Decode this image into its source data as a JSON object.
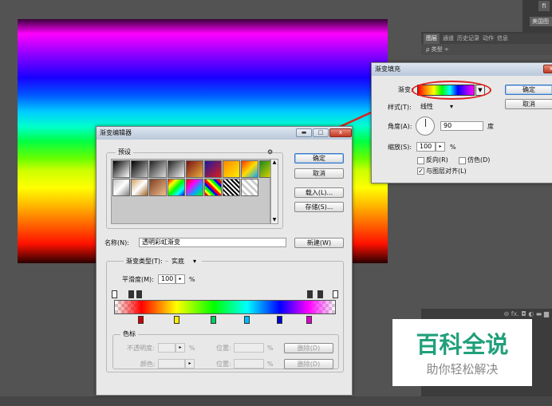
{
  "ps_top": {
    "fi_label": "fi",
    "tab_label": "美国图"
  },
  "layers_panel": {
    "tabs": [
      "图层",
      "通道",
      "历史记录",
      "动作",
      "信息"
    ],
    "filter_label": "ρ 类型 ÷",
    "bottom_icons": "⊖ fx. ◘ ◐ ▬ ▆"
  },
  "gradient_fill": {
    "title": "渐变填充",
    "gradient_label": "渐变:",
    "style_label": "样式(T):",
    "style_value": "线性",
    "angle_label": "角度(A):",
    "angle_value": "90",
    "angle_unit": "度",
    "scale_label": "缩放(S):",
    "scale_value": "100",
    "scale_unit": "%",
    "reverse_label": "反向(R)",
    "dither_label": "仿色(D)",
    "align_label": "与图层对齐(L)",
    "ok_label": "确定",
    "cancel_label": "取消",
    "reverse_checked": false,
    "dither_checked": false,
    "align_checked": true
  },
  "gradient_editor": {
    "title": "渐变编辑器",
    "presets_label": "预设",
    "ok_label": "确定",
    "cancel_label": "取消",
    "load_label": "载入(L)...",
    "save_label": "存储(S)...",
    "name_label": "名称(N):",
    "name_value": "透明彩虹渐变",
    "new_label": "新建(W)",
    "type_label": "渐变类型(T):",
    "type_value": "实底",
    "smooth_label": "平滑度(M):",
    "smooth_value": "100",
    "smooth_unit": "%",
    "stops_label": "色标",
    "opacity_label": "不透明度:",
    "opacity_unit": "%",
    "location_label": "位置:",
    "location_unit": "%",
    "delete_label": "删除(D)",
    "color_label": "颜色:",
    "preset_colors": [
      "linear-gradient(135deg,#000,#fff)",
      "linear-gradient(135deg,#000,rgba(0,0,0,0))",
      "linear-gradient(135deg,#222,#ddd)",
      "linear-gradient(135deg,#222,#f5f5f5)",
      "linear-gradient(135deg,#7a1010,#e8b040)",
      "linear-gradient(135deg,#1a1aa0,#e01a1a)",
      "linear-gradient(135deg,#ff8800,#ffee00)",
      "linear-gradient(135deg,#ff3300,#ffdd00,#00aaff)",
      "linear-gradient(135deg,#1a8a1a,#ffe000)",
      "linear-gradient(135deg,#c0c0c0,#fff,#808080)",
      "linear-gradient(135deg,#d0a060,#fff,#a06020)",
      "linear-gradient(135deg,#804020,#f0c090)",
      "linear-gradient(135deg,#ff0000,#ffff00,#00ff00,#00ffff,#0000ff)",
      "linear-gradient(135deg,#ff0000,#ff00ff,#00aaff,#00ff00)",
      "repeating-linear-gradient(45deg,#ff0000 0 3px,#ffff00 3px 6px,#00ff00 6px 9px,#0000ff 9px 12px)",
      "repeating-linear-gradient(45deg,#000 0 2px,#fff 2px 4px)",
      "repeating-linear-gradient(45deg,#fff 0 3px,#ccc 3px 6px)"
    ],
    "stop_colors": [
      "#cc0000",
      "#ffee00",
      "#00cc66",
      "#00bbff",
      "#0000cc",
      "#dd00cc"
    ]
  },
  "watermark": {
    "title": "百科全说",
    "subtitle": "助你轻松解决"
  }
}
